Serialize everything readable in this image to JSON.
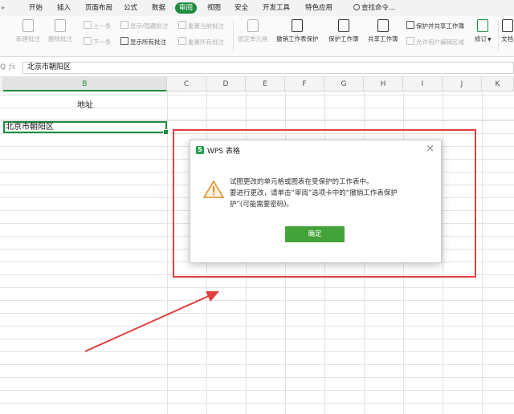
{
  "menu": {
    "tabs": [
      "开始",
      "插入",
      "页面布局",
      "公式",
      "数据",
      "审阅",
      "视图",
      "安全",
      "开发工具",
      "特色应用"
    ],
    "active_tab": "审阅",
    "search_label": "查找命令..."
  },
  "ribbon": {
    "new_comment": "新建批注",
    "delete_comment": "删除批注",
    "prev": "上一条",
    "next": "下一条",
    "show_hide_comment": "显示/隐藏批注",
    "show_all_comments": "显示所有批注",
    "reset_current_comment": "重置当前批注",
    "reset_all_comments": "重置所有批注",
    "lock_cells": "锁定单元格",
    "unprotect_sheet": "撤销工作表保护",
    "protect_workbook": "保护工作簿",
    "share_workbook": "共享工作簿",
    "protect_and_share": "保护并共享工作簿",
    "allow_edit_ranges": "允许用户编辑区域",
    "track_changes": "修订",
    "doc_compare": "文档"
  },
  "formula_bar": {
    "fx": "fx",
    "content": "北京市朝阳区"
  },
  "grid": {
    "columns": [
      "B",
      "C",
      "D",
      "E",
      "F",
      "G",
      "H",
      "I",
      "J",
      "K"
    ],
    "selected_column": "B",
    "b1": "地址",
    "b2": "北京市朝阳区"
  },
  "dialog": {
    "title": "WPS 表格",
    "logo": "S",
    "close": "×",
    "message_lines": [
      "试图更改的单元格或图表在受保护的工作表中。",
      "要进行更改，请单击“审阅”选项卡中的“撤销工作表保护",
      "护”(可能需要密码)。"
    ],
    "ok_label": "确定"
  },
  "colors": {
    "accent_green": "#1e8e3e",
    "button_green": "#44a23a",
    "annotation_red": "#e04040"
  }
}
